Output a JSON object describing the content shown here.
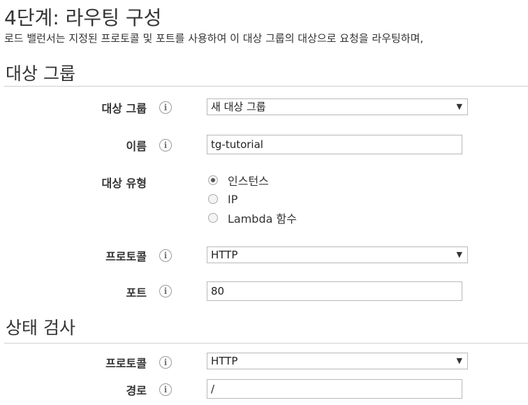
{
  "step": {
    "title": "4단계: 라우팅 구성",
    "description": "로드 밸런서는 지정된 프로토콜 및 포트를 사용하여 이 대상 그룹의 대상으로 요청을 라우팅하며,"
  },
  "target_group_section": {
    "title": "대상 그룹",
    "target_group": {
      "label": "대상 그룹",
      "selected": "새 대상 그룹"
    },
    "name": {
      "label": "이름",
      "value": "tg-tutorial"
    },
    "target_type": {
      "label": "대상 유형",
      "options": [
        "인스턴스",
        "IP",
        "Lambda 함수"
      ],
      "selected_index": 0
    },
    "protocol": {
      "label": "프로토콜",
      "selected": "HTTP"
    },
    "port": {
      "label": "포트",
      "value": "80"
    }
  },
  "health_check_section": {
    "title": "상태 검사",
    "protocol": {
      "label": "프로토콜",
      "selected": "HTTP"
    },
    "path": {
      "label": "경로",
      "value": "/"
    }
  },
  "icons": {
    "info": "info-icon",
    "dropdown": "chevron-down-icon"
  }
}
